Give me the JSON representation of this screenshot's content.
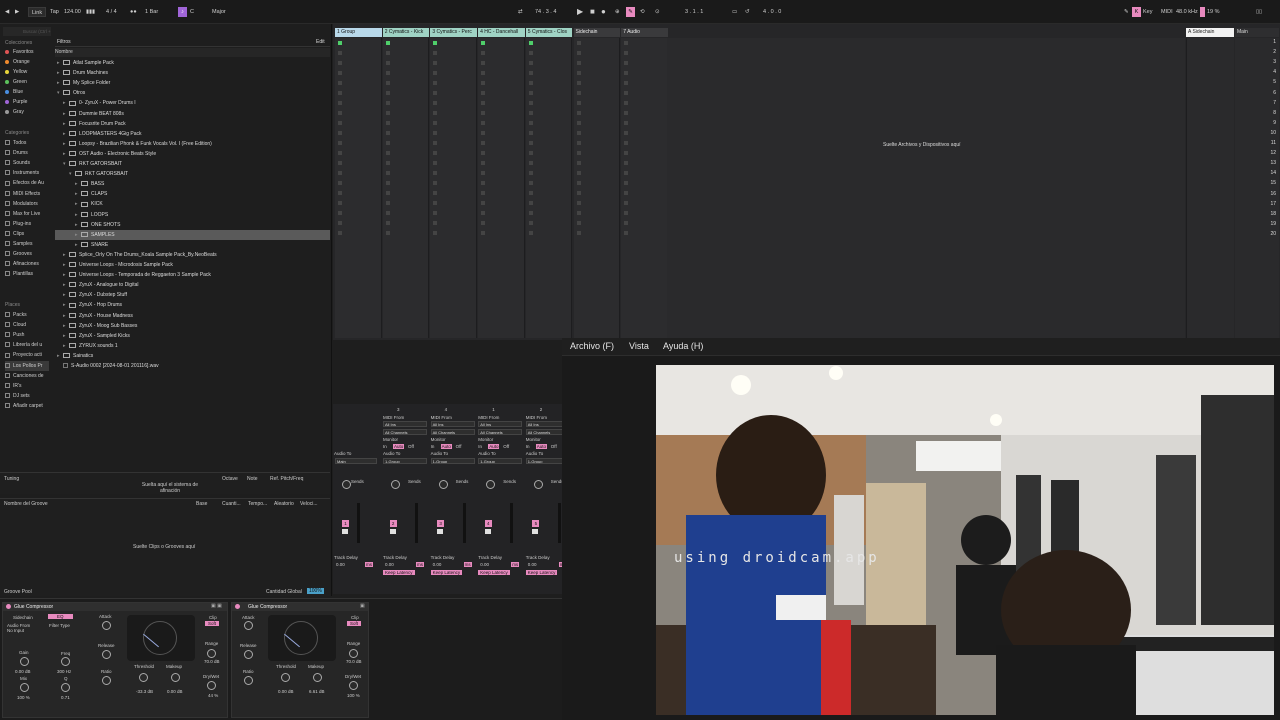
{
  "transport": {
    "link": "Link",
    "tap": "Tap",
    "tempo": "124.00",
    "signature": "4 / 4",
    "quantize": "1 Bar",
    "key": "C",
    "scale": "Major",
    "position": "74 .  3 .  4",
    "loop_start": "3 .  1 .  1",
    "loop_len": "4 .  0 .  0",
    "key_btn": "Key",
    "midi_btn": "MIDI",
    "sample_rate": "48.0 kHz",
    "cpu": "19 %"
  },
  "browser": {
    "search_placeholder": "Buscar (Ctrl + F)",
    "collections_head": "Colecciones",
    "collections": [
      {
        "label": "Favoritos",
        "color": "#e05555"
      },
      {
        "label": "Orange",
        "color": "#f08a2e"
      },
      {
        "label": "Yellow",
        "color": "#e8d43a"
      },
      {
        "label": "Green",
        "color": "#5cc25c"
      },
      {
        "label": "Blue",
        "color": "#4a8fe0"
      },
      {
        "label": "Purple",
        "color": "#a065d8"
      },
      {
        "label": "Gray",
        "color": "#9a9a9a"
      }
    ],
    "categories_head": "Categories",
    "categories": [
      "Todos",
      "Drums",
      "Sounds",
      "Instruments",
      "Efectos de Au",
      "MIDI Effects",
      "Modulators",
      "Max for Live",
      "Plug-ins",
      "Clips",
      "Samples",
      "Grooves",
      "Afinaciones",
      "Plantillas"
    ],
    "places_head": "Places",
    "places": [
      "Packs",
      "Cloud",
      "Push",
      "Librería del u",
      "Proyecto acti",
      "Los Pollos Pr",
      "Canciones de",
      "IR's",
      "DJ sets",
      "Añadir carpet"
    ],
    "filters": "Filtros",
    "edit": "Edit",
    "name_col": "Nombre",
    "files": [
      {
        "depth": 0,
        "label": "Atlat Sample Pack",
        "open": false
      },
      {
        "depth": 0,
        "label": "Drum Machines",
        "open": false
      },
      {
        "depth": 0,
        "label": "My Splice Folder",
        "open": false
      },
      {
        "depth": 0,
        "label": "Otros",
        "open": true
      },
      {
        "depth": 1,
        "label": "0- ZyruX - Power Drums I",
        "open": false
      },
      {
        "depth": 1,
        "label": "Dummie BEAT 808s",
        "open": false
      },
      {
        "depth": 1,
        "label": "Focusrite  Drum  Pack",
        "open": false
      },
      {
        "depth": 1,
        "label": "LOOPMASTERS 4Gig Pack",
        "open": false
      },
      {
        "depth": 1,
        "label": "Loopsy - Brazilian Phonk & Funk Vocals Vol. I (Free Edition)",
        "open": false
      },
      {
        "depth": 1,
        "label": "OST Audio - Electronic Beats Style",
        "open": false
      },
      {
        "depth": 1,
        "label": "RKT GATORSBAIT",
        "open": true
      },
      {
        "depth": 2,
        "label": "RKT GATORSBAIT",
        "open": true
      },
      {
        "depth": 3,
        "label": "BASS",
        "open": false
      },
      {
        "depth": 3,
        "label": "CLAPS",
        "open": false
      },
      {
        "depth": 3,
        "label": "KICK",
        "open": false
      },
      {
        "depth": 3,
        "label": "LOOPS",
        "open": false
      },
      {
        "depth": 3,
        "label": "ONE SHOTS",
        "open": false
      },
      {
        "depth": 3,
        "label": "SAMPLES",
        "open": false,
        "selected": true
      },
      {
        "depth": 3,
        "label": "SNARE",
        "open": false
      },
      {
        "depth": 1,
        "label": "Splice_Orly On The Drums_Koala Sample Pack_By.NeoBeats",
        "open": false
      },
      {
        "depth": 1,
        "label": "Universe Loops - Microdosis Sample Pack",
        "open": false
      },
      {
        "depth": 1,
        "label": "Universe Loops - Temporada de Reggaeton 3 Sample Pack",
        "open": false
      },
      {
        "depth": 1,
        "label": "ZyruX - Analogue to Digital",
        "open": false
      },
      {
        "depth": 1,
        "label": "ZyruX - Dubstep Stuff",
        "open": false
      },
      {
        "depth": 1,
        "label": "ZyruX - Hop Drums",
        "open": false
      },
      {
        "depth": 1,
        "label": "ZyruX - House Madness",
        "open": false
      },
      {
        "depth": 1,
        "label": "ZyruX - Moog Sub Basses",
        "open": false
      },
      {
        "depth": 1,
        "label": "ZyruX - Sampled Kicks",
        "open": false
      },
      {
        "depth": 1,
        "label": "ZYRUX sounds 1",
        "open": false
      },
      {
        "depth": 0,
        "label": "Sainatics",
        "open": false
      },
      {
        "depth": 0,
        "label": "S-Audio 0002 [2024-08-01 201116].wav",
        "open": false,
        "file": true
      }
    ],
    "tuning_label": "Tuning",
    "tuning_drop": "Suelta aquí el sistema de afinación",
    "tuning_cols": [
      "Octave",
      "Note",
      "Ref. Pitch/Freq"
    ],
    "groove_cols": [
      "Nombre del Groove",
      "Base",
      "Cuanti...",
      "Tempo...",
      "Aleatorio",
      "Veloci..."
    ],
    "groove_drop": "Suelte Clips o Grooves aquí",
    "groove_pool": "Groove Pool",
    "global_amount_label": "Cantidad Global",
    "global_amount": "100%"
  },
  "session": {
    "tracks": [
      {
        "name": "1 Group",
        "color": "#b9d9ea"
      },
      {
        "name": "2 Cymatics - Kick",
        "color": "#9fd3c4"
      },
      {
        "name": "3 Cymatics - Perc",
        "color": "#9fd3c4"
      },
      {
        "name": "4 HC - Dancehall",
        "color": "#9fd3c4"
      },
      {
        "name": "5 Cymatics - Clos",
        "color": "#9fd3c4"
      },
      {
        "name": "Sidechain",
        "color": "#3a3a3c"
      },
      {
        "name": "7 Audio",
        "color": "#3a3a3c"
      }
    ],
    "drop_text": "Suelte Archivos y Dispositivos aquí",
    "return_track": "A Sidechain",
    "main_track": "Main",
    "scenes": [
      "1",
      "2",
      "3",
      "4",
      "5",
      "6",
      "7",
      "8",
      "9",
      "10",
      "11",
      "12",
      "13",
      "14",
      "15",
      "16",
      "17",
      "18",
      "19",
      "20"
    ]
  },
  "mixer": {
    "midi_from": "MIDI From",
    "all_ins": "All Ins",
    "all_channels": "All Channels",
    "monitor": "Monitor",
    "in_label": "In",
    "auto_label": "Auto",
    "off_label": "Off",
    "audio_to": "Audio To",
    "main": "Main",
    "group_dest": "1-Group",
    "sends": "Sends",
    "track_delay": "Track Delay",
    "delay_val": "0.00",
    "keep_latency": "Keep Latency",
    "ms": "ms",
    "track_numbers": [
      "1",
      "2",
      "3",
      "4",
      "5"
    ],
    "counts": [
      "3",
      "4",
      "1",
      "2"
    ]
  },
  "devices": [
    {
      "title": "Glue Compressor",
      "sidechain": "Sidechain",
      "ef": "EQ",
      "audio_from": "Audio From",
      "no_input": "No Input",
      "filter_type": "Filter Type",
      "attack": "Attack",
      "release": "Release",
      "ratio": "Ratio",
      "gain": "Gain",
      "gain_val": "0.00 dB",
      "mix": "Mix",
      "mix_val": "100 %",
      "freq": "Freq",
      "freq_val": "300 Hz",
      "q": "Q",
      "q_val": "0.71",
      "threshold": "Threshold",
      "threshold_val": "-33.3 dB",
      "makeup": "Makeup",
      "makeup_val": "0.00 dB",
      "clip": "Clip",
      "soft": "Soft",
      "range": "Range",
      "range_val": "70.0 dB",
      "drywet": "Dry/Wet",
      "drywet_val": "44 %"
    },
    {
      "title": "Glue Compressor",
      "attack": "Attack",
      "release": "Release",
      "ratio": "Ratio",
      "threshold": "Threshold",
      "threshold_val": "0.00 dB",
      "makeup": "Makeup",
      "makeup_val": "6.61 dB",
      "clip": "Clip",
      "soft": "Soft",
      "range": "Range",
      "range_val": "70.0 dB",
      "drywet": "Dry/Wet",
      "drywet_val": "100 %"
    }
  ],
  "webcam": {
    "menu": [
      "Archivo (F)",
      "Vista",
      "Ayuda (H)"
    ],
    "watermark": "using droidcam.app"
  }
}
